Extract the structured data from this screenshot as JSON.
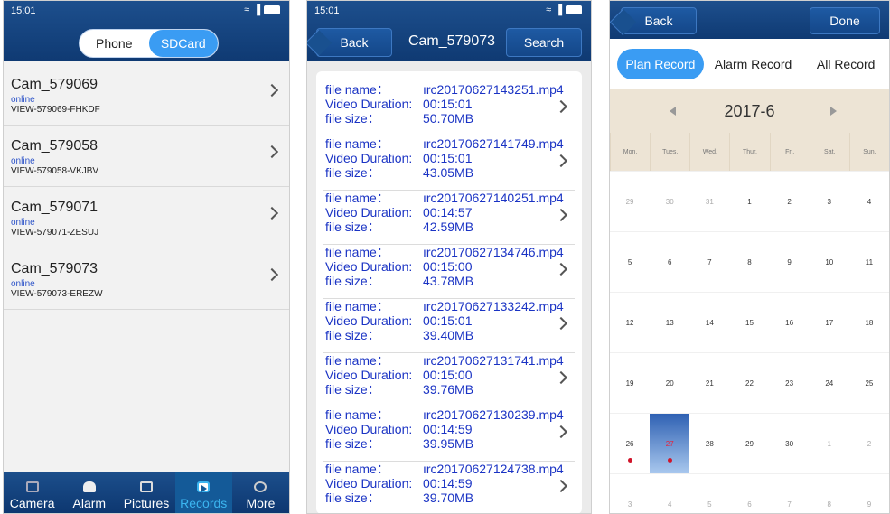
{
  "panel1": {
    "status_time": "15:01",
    "toggle": {
      "phone": "Phone",
      "sdcard": "SDCard"
    },
    "devices": [
      {
        "name": "Cam_579069",
        "status": "online",
        "code": "VIEW-579069-FHKDF"
      },
      {
        "name": "Cam_579058",
        "status": "online",
        "code": "VIEW-579058-VKJBV"
      },
      {
        "name": "Cam_579071",
        "status": "online",
        "code": "VIEW-579071-ZESUJ"
      },
      {
        "name": "Cam_579073",
        "status": "online",
        "code": "VIEW-579073-EREZW"
      }
    ],
    "tabs": [
      "Camera",
      "Alarm",
      "Pictures",
      "Records",
      "More"
    ],
    "active_tab": "Records"
  },
  "panel2": {
    "status_time": "15:01",
    "back": "Back",
    "title": "Cam_579073",
    "search": "Search",
    "labels": {
      "file_name": "file name：",
      "duration": "Video Duration:",
      "size": "file size："
    },
    "files": [
      {
        "name": "ırc20170627143251.mp4",
        "duration": "00:15:01",
        "size": "50.70MB"
      },
      {
        "name": "ırc20170627141749.mp4",
        "duration": "00:15:01",
        "size": "43.05MB"
      },
      {
        "name": "ırc20170627140251.mp4",
        "duration": "00:14:57",
        "size": "42.59MB"
      },
      {
        "name": "ırc20170627134746.mp4",
        "duration": "00:15:00",
        "size": "43.78MB"
      },
      {
        "name": "ırc20170627133242.mp4",
        "duration": "00:15:01",
        "size": "39.40MB"
      },
      {
        "name": "ırc20170627131741.mp4",
        "duration": "00:15:00",
        "size": "39.76MB"
      },
      {
        "name": "ırc20170627130239.mp4",
        "duration": "00:14:59",
        "size": "39.95MB"
      },
      {
        "name": "ırc20170627124738.mp4",
        "duration": "00:14:59",
        "size": "39.70MB"
      }
    ]
  },
  "panel3": {
    "back": "Back",
    "done": "Done",
    "segments": [
      "Plan Record",
      "Alarm Record",
      "All Record"
    ],
    "month": "2017-6",
    "weekdays": [
      "Mon.",
      "Tues.",
      "Wed.",
      "Thur.",
      "Fri.",
      "Sat.",
      "Sun."
    ],
    "weeks": [
      [
        "29",
        "30",
        "31",
        "1",
        "2",
        "3",
        "4"
      ],
      [
        "5",
        "6",
        "7",
        "8",
        "9",
        "10",
        "11"
      ],
      [
        "12",
        "13",
        "14",
        "15",
        "16",
        "17",
        "18"
      ],
      [
        "19",
        "20",
        "21",
        "22",
        "23",
        "24",
        "25"
      ],
      [
        "26",
        "27",
        "28",
        "29",
        "30",
        "1",
        "2"
      ],
      [
        "3",
        "4",
        "5",
        "6",
        "7",
        "8",
        "9"
      ]
    ],
    "selected_day": "27",
    "marked_days": [
      "26",
      "27"
    ],
    "colors": {
      "header": "#0f3a73",
      "accent": "#3a9cf3",
      "record_dot": "#d0152b"
    }
  }
}
